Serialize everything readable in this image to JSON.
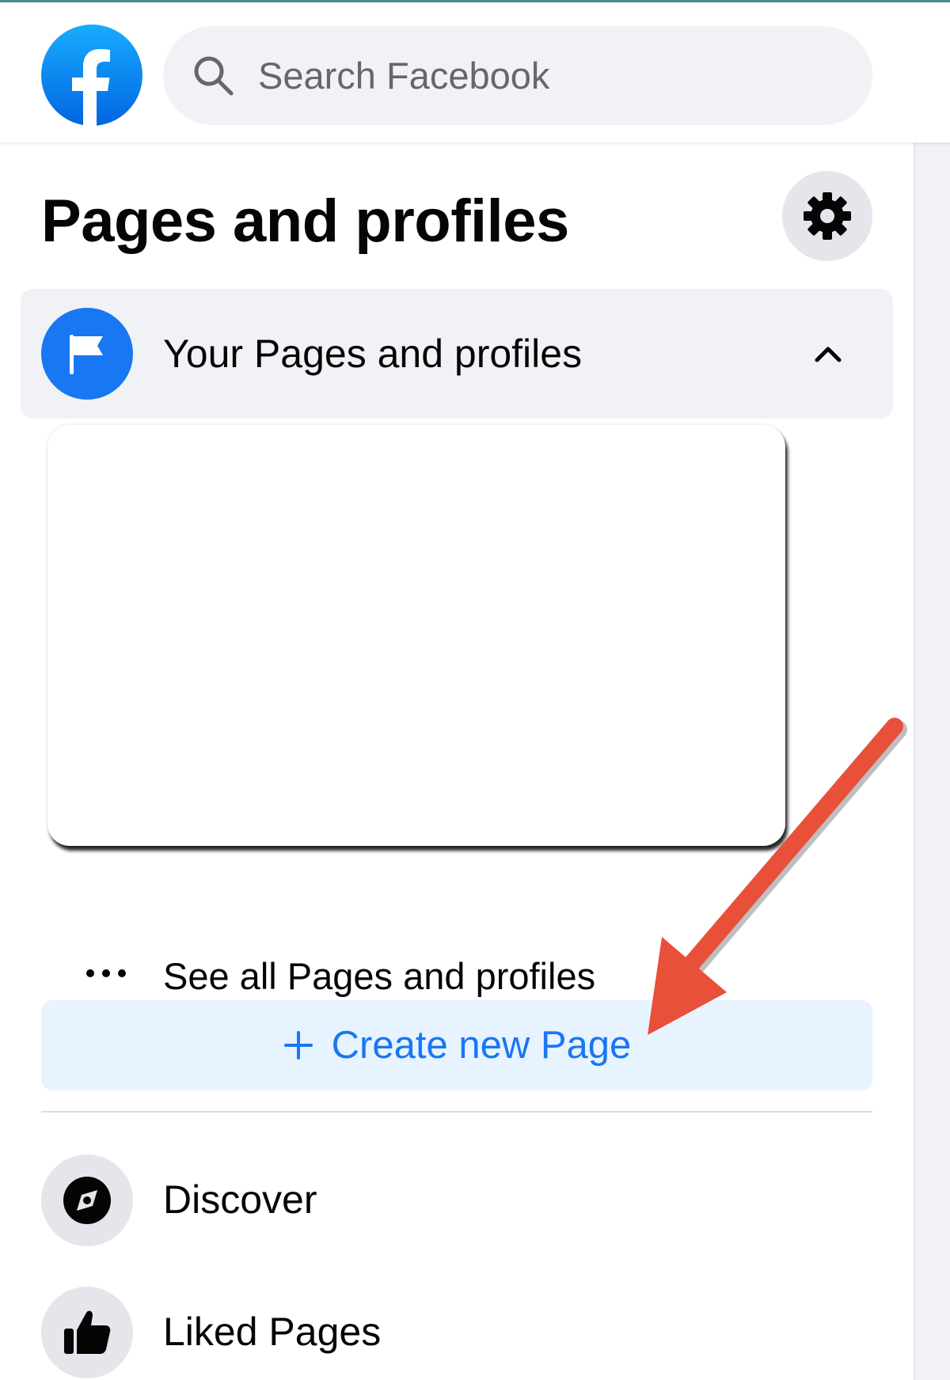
{
  "header": {
    "logo_icon": "facebook-logo-icon",
    "search": {
      "placeholder": "Search Facebook",
      "icon": "search-icon"
    }
  },
  "sidebar": {
    "title": "Pages and profiles",
    "settings_icon": "gear-icon",
    "your_pages": {
      "label": "Your Pages and profiles",
      "icon": "flag-icon",
      "expanded": true
    },
    "see_all": {
      "label": "See all Pages and profiles",
      "icon": "more-dots-icon"
    },
    "create_button": {
      "label": "Create new Page",
      "icon": "plus-icon"
    },
    "nav_items": [
      {
        "label": "Discover",
        "icon": "compass-icon"
      },
      {
        "label": "Liked Pages",
        "icon": "thumbs-up-icon"
      }
    ]
  },
  "colors": {
    "brand_blue": "#1877f2",
    "surface_gray": "#f0f2f5",
    "create_button_bg": "#e7f3ff",
    "annotation_arrow": "#e8503a"
  }
}
